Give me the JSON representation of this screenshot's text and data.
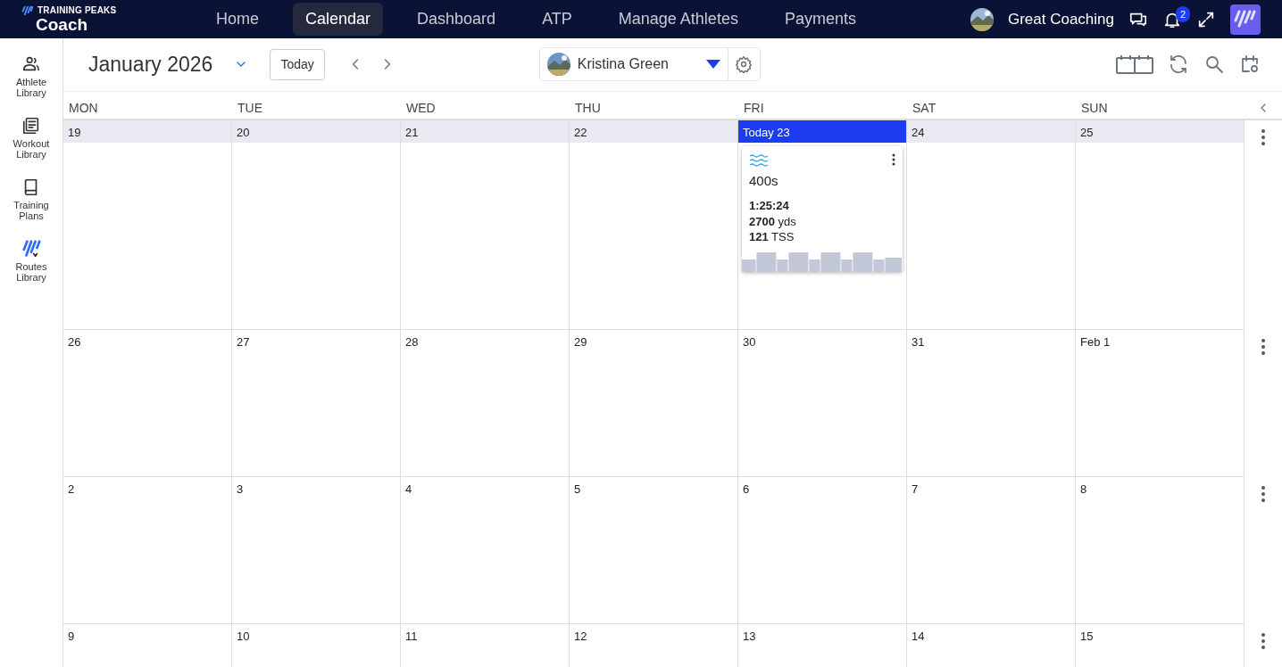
{
  "brand": {
    "top": "TRAINING PEAKS",
    "bottom": "Coach"
  },
  "nav": [
    {
      "label": "Home",
      "selected": false
    },
    {
      "label": "Calendar",
      "selected": true
    },
    {
      "label": "Dashboard",
      "selected": false
    },
    {
      "label": "ATP",
      "selected": false
    },
    {
      "label": "Manage Athletes",
      "selected": false
    },
    {
      "label": "Payments",
      "selected": false
    }
  ],
  "account": {
    "name": "Great Coaching",
    "notifications": "2"
  },
  "sidebar": [
    {
      "kind": "athletes",
      "label": "Athlete Library"
    },
    {
      "kind": "workouts",
      "label": "Workout Library"
    },
    {
      "kind": "plans",
      "label": "Training Plans"
    },
    {
      "kind": "routes",
      "label": "Routes Library"
    }
  ],
  "toolbar": {
    "month": "January 2026",
    "today_button": "Today",
    "athlete": "Kristina Green"
  },
  "weekdays": [
    "MON",
    "TUE",
    "WED",
    "THU",
    "FRI",
    "SAT",
    "SUN"
  ],
  "weeks": [
    {
      "current": true,
      "days": [
        {
          "label": "19",
          "today": false
        },
        {
          "label": "20",
          "today": false
        },
        {
          "label": "21",
          "today": false
        },
        {
          "label": "22",
          "today": false
        },
        {
          "label": "Today 23",
          "today": true,
          "workouts": [
            {
              "kind": "swim",
              "title": "400s",
              "duration": "1:25:24",
              "distance": "**2700** yds",
              "tss": "**121** TSS"
            }
          ]
        },
        {
          "label": "24",
          "today": false
        },
        {
          "label": "25",
          "today": false
        }
      ]
    },
    {
      "current": false,
      "days": [
        {
          "label": "26",
          "today": false
        },
        {
          "label": "27",
          "today": false
        },
        {
          "label": "28",
          "today": false
        },
        {
          "label": "29",
          "today": false
        },
        {
          "label": "30",
          "today": false
        },
        {
          "label": "31",
          "today": false
        },
        {
          "label": "Feb 1",
          "today": false
        }
      ]
    },
    {
      "current": false,
      "days": [
        {
          "label": "2",
          "today": false
        },
        {
          "label": "3",
          "today": false
        },
        {
          "label": "4",
          "today": false
        },
        {
          "label": "5",
          "today": false
        },
        {
          "label": "6",
          "today": false
        },
        {
          "label": "7",
          "today": false
        },
        {
          "label": "8",
          "today": false
        }
      ]
    },
    {
      "current": false,
      "days": [
        {
          "label": "9",
          "today": false
        },
        {
          "label": "10",
          "today": false
        },
        {
          "label": "11",
          "today": false
        },
        {
          "label": "12",
          "today": false
        },
        {
          "label": "13",
          "today": false
        },
        {
          "label": "14",
          "today": false
        },
        {
          "label": "15",
          "today": false
        }
      ]
    }
  ]
}
